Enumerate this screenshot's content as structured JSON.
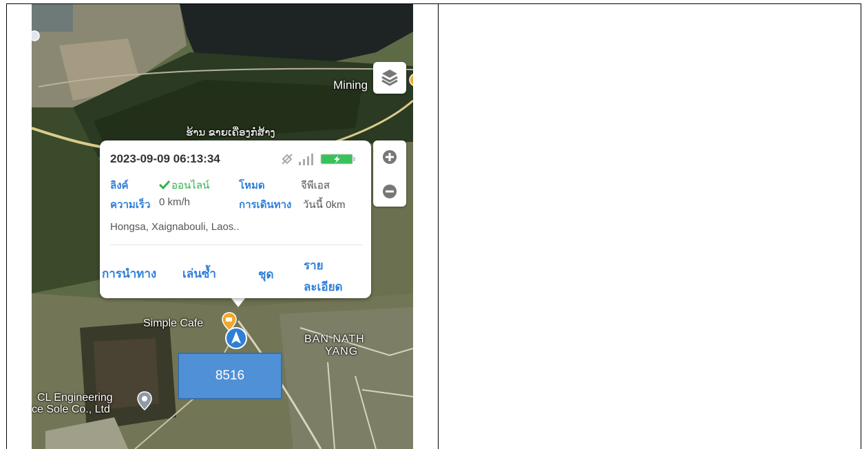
{
  "map": {
    "labels": {
      "mining": "Mining",
      "shop": "ຮ້ານ ຂາຍເຄື່ອງກໍ່ສ້າງ",
      "cafe": "Simple Cafe",
      "village_line1": "BAN NATH",
      "village_line2": "YANG",
      "company_line1": "CL Engineering",
      "company_line2": "ce Sole Co., Ltd"
    },
    "icons": [
      "layers-icon",
      "zoom-in-icon",
      "zoom-out-icon",
      "cafe-pin-icon",
      "navigation-arrow-icon",
      "location-pin-icon"
    ]
  },
  "popup": {
    "timestamp": "2023-09-09 06:13:34",
    "status_icons": [
      "gps-off-icon",
      "signal-icon",
      "battery-charging-icon"
    ],
    "link_label": "ลิงค์",
    "link_value": "ออนไลน์",
    "mode_label": "โหมด",
    "mode_value": "จีพีเอส",
    "speed_label": "ความเร็ว",
    "speed_value": "0 km/h",
    "trip_label": "การเดินทาง",
    "trip_value": "วันนี้ 0km",
    "address": "Hongsa, Xaignabouli, Laos..",
    "actions": {
      "navigate": "การนำทาง",
      "replay": "เล่นซ้ำ",
      "set": "ชุด",
      "detail_line1": "ราย",
      "detail_line2": "ละเอียด"
    }
  },
  "overlay_box": {
    "text": "8516"
  },
  "colors": {
    "accent": "#2f7fd8",
    "online": "#35b04a",
    "battery": "#37c25a",
    "box": "#4f90d6"
  }
}
